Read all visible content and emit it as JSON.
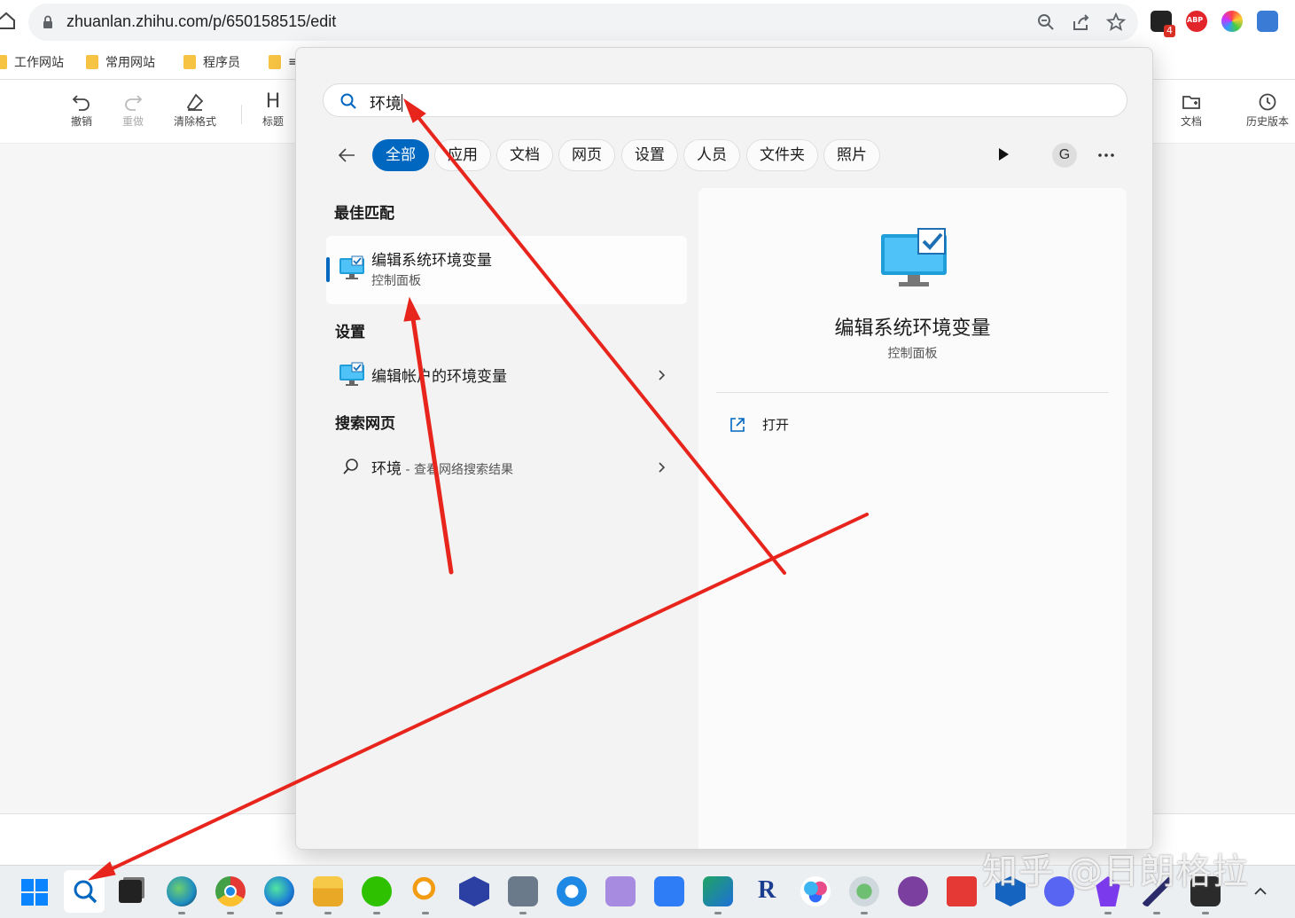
{
  "browser": {
    "url": "zhuanlan.zhihu.com/p/650158515/edit",
    "extension_badge": "4",
    "extension_abp": "ABP",
    "bookmarks": [
      "工作网站",
      "常用网站",
      "程序员",
      "≡"
    ]
  },
  "editor_toolbar": {
    "undo": "撤销",
    "redo": "重做",
    "clear_format": "清除格式",
    "heading": "标题",
    "heading_glyph": "H",
    "document": "文档",
    "history": "历史版本"
  },
  "search": {
    "query": "环境",
    "filters": [
      "全部",
      "应用",
      "文档",
      "网页",
      "设置",
      "人员",
      "文件夹",
      "照片"
    ],
    "active_filter": "全部",
    "account_initial": "G",
    "sections": {
      "best_match": "最佳匹配",
      "settings": "设置",
      "web": "搜索网页"
    },
    "best_match": {
      "title": "编辑系统环境变量",
      "subtitle": "控制面板"
    },
    "settings_result": {
      "title": "编辑帐户的环境变量"
    },
    "web_result": {
      "query": "环境",
      "suffix": " - 查看网络搜索结果"
    },
    "detail": {
      "title": "编辑系统环境变量",
      "subtitle": "控制面板",
      "action_open": "打开"
    }
  },
  "taskbar": {
    "apps": [
      "start-icon",
      "search-icon",
      "task-view-icon",
      "edge-dev-icon",
      "chrome-icon",
      "edge-icon",
      "file-explorer-icon",
      "wechat-icon",
      "magnifier-app-icon",
      "c-app-icon",
      "screenshot-app-icon",
      "qq-browser-icon",
      "m-app-icon",
      "feishu-icon",
      "email-app-icon",
      "r-app-icon",
      "baidu-netdisk-icon",
      "shell-app-icon",
      "github-icon",
      "toutiao-icon",
      "box-app-icon",
      "discord-icon",
      "obsidian-icon",
      "sail-app-icon",
      "terminal-icon"
    ],
    "watermark": "知乎 @日朗格拉"
  },
  "colors": {
    "accent": "#0067c0",
    "arrow": "#e8251d"
  }
}
